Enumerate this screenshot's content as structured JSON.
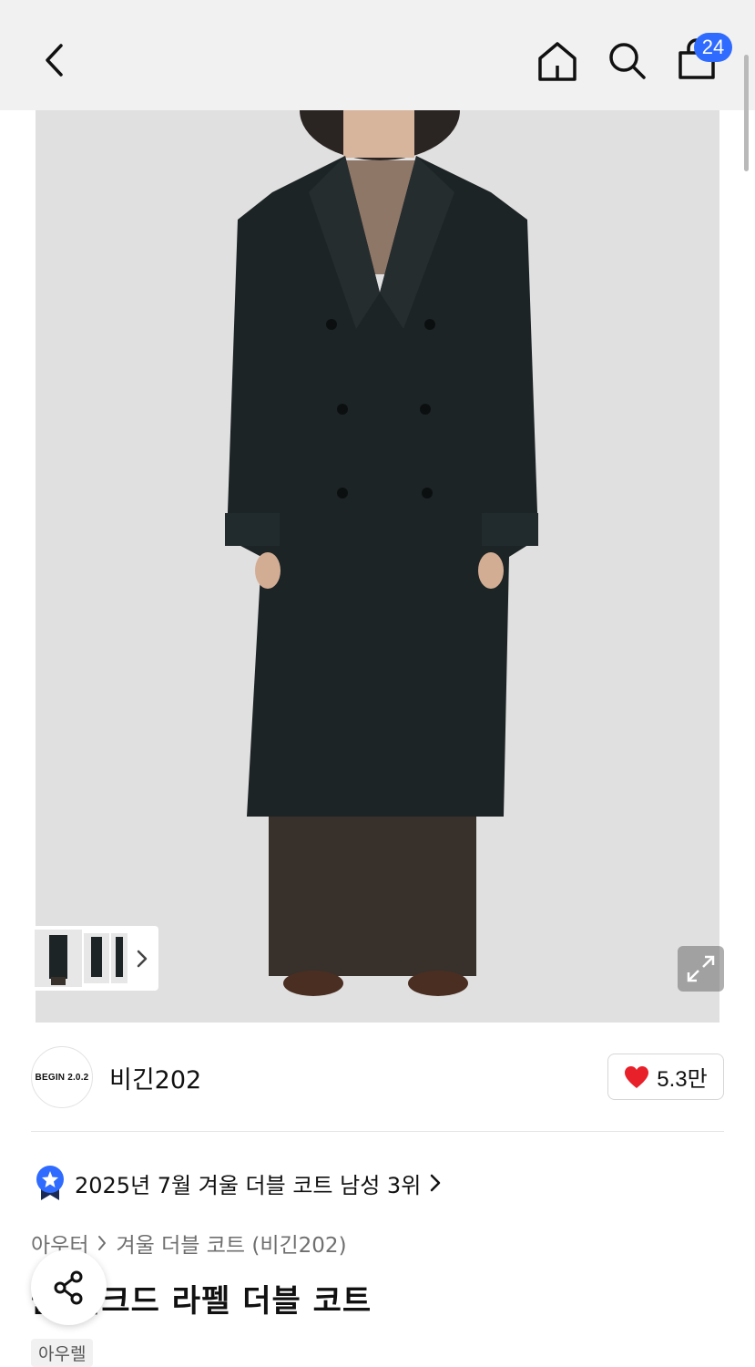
{
  "header": {
    "back_icon": "chevron-left-icon",
    "home_icon": "home-icon",
    "search_icon": "search-icon",
    "cart_icon": "shopping-bag-icon",
    "cart_count": "24",
    "accent_color": "#2f6bff"
  },
  "gallery": {
    "photo_description_icon": "product-photo",
    "thumb_next_icon": "chevron-right-icon",
    "expand_icon": "expand-icon"
  },
  "brand": {
    "logo_text": "BEGIN 2.0.2",
    "name": "비긴202"
  },
  "like": {
    "icon": "heart-icon",
    "count": "5.3만",
    "color": "#e8202a"
  },
  "ranking": {
    "icon": "rank-badge-icon",
    "text": "2025년 7월 겨울 더블 코트 남성 3위"
  },
  "breadcrumb": {
    "items": [
      "아우터",
      "겨울 더블 코트 (비긴202)"
    ]
  },
  "product": {
    "title": "울 피크드 라펠 더블 코트",
    "tag": "아우렐"
  },
  "share": {
    "icon": "share-icon"
  }
}
